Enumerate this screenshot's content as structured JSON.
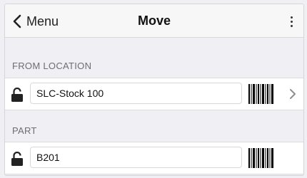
{
  "navbar": {
    "back_label": "Menu",
    "title": "Move"
  },
  "sections": {
    "from_location": {
      "label": "FROM LOCATION",
      "value": "SLC-Stock 100"
    },
    "part": {
      "label": "PART",
      "value": "B201"
    }
  },
  "icons": {
    "back": "chevron-left-icon",
    "menu": "more-vertical-icon",
    "lock": "unlocked-padlock-icon",
    "scan": "barcode-icon",
    "detail": "chevron-right-icon"
  }
}
